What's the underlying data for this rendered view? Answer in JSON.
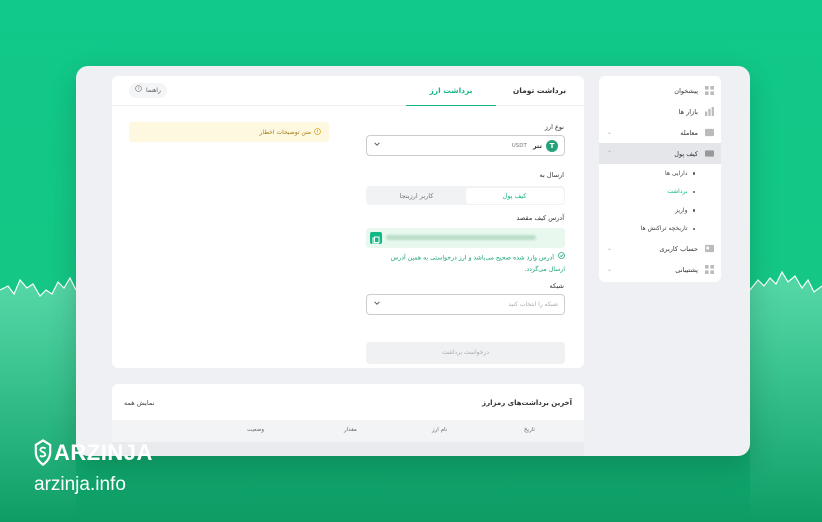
{
  "sidebar": {
    "items": [
      {
        "label": "پیشخوان",
        "icon": "dashboard-icon"
      },
      {
        "label": "بازار ها",
        "icon": "chart-icon"
      },
      {
        "label": "معامله",
        "icon": "exchange-icon"
      },
      {
        "label": "کیف پول",
        "icon": "wallet-icon"
      }
    ],
    "sub_items": [
      "دارایی ها",
      "برداشت",
      "واریز",
      "تاریخچه تراکنش ها"
    ],
    "bottom_items": [
      {
        "label": "حساب کاربری",
        "icon": "user-card-icon"
      },
      {
        "label": "پشتیبانی",
        "icon": "support-icon"
      }
    ]
  },
  "main": {
    "tabs": [
      "برداشت تومان",
      "برداشت ارز"
    ],
    "help": "راهنما",
    "warning": "متن توضیحات اخطار",
    "currency_label": "نوع ارز",
    "currency_name": "تتر",
    "currency_code": "USDT",
    "send_to_label": "ارسال به",
    "segments": [
      "کیف پول",
      "کاربر ارزینجا"
    ],
    "address_label": "آدرس کیف مقصد",
    "address_ok_message": "آدرس وارد شده صحیح می‌باشد و ارز درخواستی به همین آدرس ارسال می‌گردد.",
    "network_label": "شبکه",
    "network_placeholder": "شبکه را انتخاب کنید",
    "submit": "درخواست برداشت"
  },
  "history": {
    "title": "آخرین برداشت‌های رمزارز",
    "show_all": "نمایش همه",
    "columns": [
      "تاریخ",
      "نام ارز",
      "مقدار",
      "وضعیت"
    ]
  },
  "brand": {
    "name": "ARZINJA",
    "url": "arzinja.info"
  },
  "colors": {
    "accent": "#12b886",
    "tether": "#26a17b",
    "background": "#14c784"
  }
}
